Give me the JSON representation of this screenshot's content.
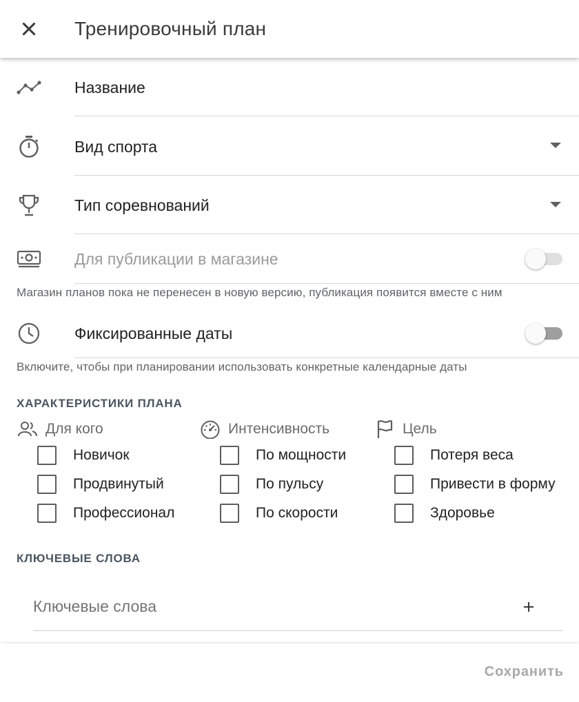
{
  "header": {
    "title": "Тренировочный план"
  },
  "form": {
    "name_label": "Название",
    "sport_label": "Вид спорта",
    "competition_label": "Тип соревнований",
    "store_label": "Для публикации в магазине",
    "store_hint": "Магазин планов пока не перенесен в новую версию, публикация появится вместе с ним",
    "fixed_dates_label": "Фиксированные даты",
    "fixed_dates_hint": "Включите, чтобы при планировании использовать конкретные календарные даты"
  },
  "characteristics": {
    "title": "ХАРАКТЕРИСТИКИ ПЛАНА",
    "columns": [
      {
        "label": "Для кого",
        "icon": "people-icon",
        "options": [
          "Новичок",
          "Продвинутый",
          "Профессионал"
        ]
      },
      {
        "label": "Интенсивность",
        "icon": "speedometer-icon",
        "options": [
          "По мощности",
          "По пульсу",
          "По скорости"
        ]
      },
      {
        "label": "Цель",
        "icon": "flag-icon",
        "options": [
          "Потеря веса",
          "Привести в форму",
          "Здоровье"
        ]
      }
    ]
  },
  "keywords": {
    "title": "КЛЮЧЕВЫЕ СЛОВА",
    "placeholder": "Ключевые слова"
  },
  "footer": {
    "save_label": "Сохранить"
  },
  "colors": {
    "icon": "#5f5f5f",
    "toggle_track_off": "#9e9e9e",
    "toggle_track_disabled": "#e0e0e0",
    "disabled_text": "#9a9a9a"
  }
}
